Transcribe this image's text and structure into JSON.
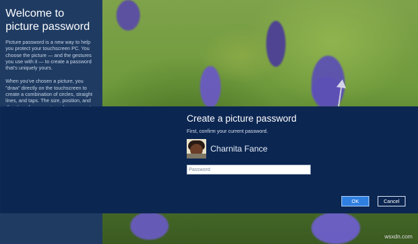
{
  "left_panel": {
    "title": "Welcome to picture password",
    "paragraphs": [
      "Picture password is a new way to help you protect your touchscreen PC. You choose the picture — and the gestures you use with it — to create a password that's uniquely yours.",
      "When you've chosen a picture, you \"draw\" directly on the touchscreen to create a combination of circles, straight lines, and taps. The size, position, and direction of your gestures become part"
    ]
  },
  "dialog": {
    "title": "Create a picture password",
    "subtitle": "First, confirm your current password.",
    "user_name": "Charnita Fance",
    "password_placeholder": "Password",
    "ok_label": "OK",
    "cancel_label": "Cancel"
  },
  "watermark": "wsxdn.com",
  "colors": {
    "left_panel_bg": "#1f3b62",
    "dialog_bg": "#0c2652",
    "ok_button": "#2f7fe0"
  },
  "icons": {
    "avatar": "user-photo"
  }
}
